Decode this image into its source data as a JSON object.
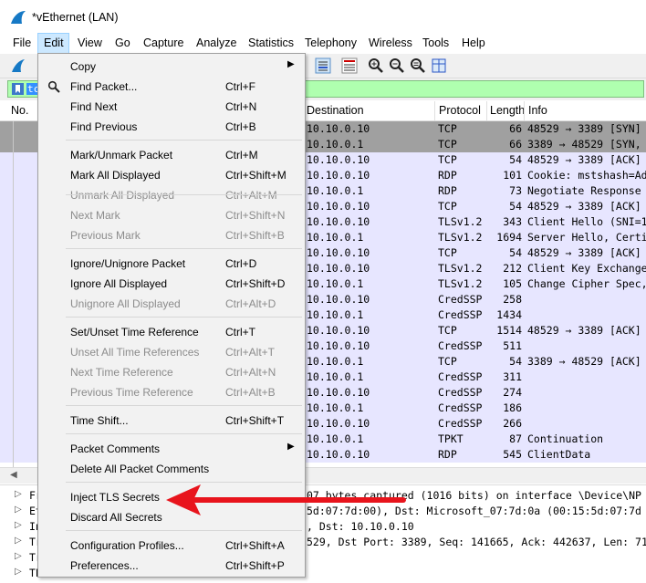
{
  "window": {
    "title": "*vEthernet (LAN)"
  },
  "menubar": {
    "items": [
      "File",
      "Edit",
      "View",
      "Go",
      "Capture",
      "Analyze",
      "Statistics",
      "Telephony",
      "Wireless",
      "Tools",
      "Help"
    ]
  },
  "filter": {
    "text": "tc"
  },
  "packet_list": {
    "headers": {
      "no": "No.",
      "destination": "Destination",
      "protocol": "Protocol",
      "length": "Length",
      "info": "Info"
    },
    "rows": [
      {
        "dst": "10.10.0.10",
        "proto": "TCP",
        "len": "66",
        "info": "48529 → 3389 [SYN]",
        "style": "selected"
      },
      {
        "dst": "10.10.0.1",
        "proto": "TCP",
        "len": "66",
        "info": "3389 → 48529 [SYN,",
        "style": "selected"
      },
      {
        "dst": "10.10.0.10",
        "proto": "TCP",
        "len": "54",
        "info": "48529 → 3389 [ACK]",
        "style": "normal"
      },
      {
        "dst": "10.10.0.10",
        "proto": "RDP",
        "len": "101",
        "info": "Cookie: mstshash=Ad",
        "style": "normal"
      },
      {
        "dst": "10.10.0.1",
        "proto": "RDP",
        "len": "73",
        "info": "Negotiate Response",
        "style": "normal"
      },
      {
        "dst": "10.10.0.10",
        "proto": "TCP",
        "len": "54",
        "info": "48529 → 3389 [ACK]",
        "style": "normal"
      },
      {
        "dst": "10.10.0.10",
        "proto": "TLSv1.2",
        "len": "343",
        "info": "Client Hello (SNI=1",
        "style": "normal"
      },
      {
        "dst": "10.10.0.1",
        "proto": "TLSv1.2",
        "len": "1694",
        "info": "Server Hello, Certi",
        "style": "normal"
      },
      {
        "dst": "10.10.0.10",
        "proto": "TCP",
        "len": "54",
        "info": "48529 → 3389 [ACK]",
        "style": "normal"
      },
      {
        "dst": "10.10.0.10",
        "proto": "TLSv1.2",
        "len": "212",
        "info": "Client Key Exchange",
        "style": "normal"
      },
      {
        "dst": "10.10.0.1",
        "proto": "TLSv1.2",
        "len": "105",
        "info": "Change Cipher Spec,",
        "style": "normal"
      },
      {
        "dst": "10.10.0.10",
        "proto": "CredSSP",
        "len": "258",
        "info": "",
        "style": "normal"
      },
      {
        "dst": "10.10.0.1",
        "proto": "CredSSP",
        "len": "1434",
        "info": "",
        "style": "normal"
      },
      {
        "dst": "10.10.0.10",
        "proto": "TCP",
        "len": "1514",
        "info": "48529 → 3389 [ACK]",
        "style": "normal"
      },
      {
        "dst": "10.10.0.10",
        "proto": "CredSSP",
        "len": "511",
        "info": "",
        "style": "normal"
      },
      {
        "dst": "10.10.0.1",
        "proto": "TCP",
        "len": "54",
        "info": "3389 → 48529 [ACK]",
        "style": "normal"
      },
      {
        "dst": "10.10.0.1",
        "proto": "CredSSP",
        "len": "311",
        "info": "",
        "style": "normal"
      },
      {
        "dst": "10.10.0.10",
        "proto": "CredSSP",
        "len": "274",
        "info": "",
        "style": "normal"
      },
      {
        "dst": "10.10.0.1",
        "proto": "CredSSP",
        "len": "186",
        "info": "",
        "style": "normal"
      },
      {
        "dst": "10.10.0.10",
        "proto": "CredSSP",
        "len": "266",
        "info": "",
        "style": "normal"
      },
      {
        "dst": "10.10.0.1",
        "proto": "TPKT",
        "len": "87",
        "info": "Continuation",
        "style": "normal"
      },
      {
        "dst": "10.10.0.10",
        "proto": "RDP",
        "len": "545",
        "info": "ClientData",
        "style": "normal"
      }
    ]
  },
  "details": {
    "rows": [
      {
        "prefix": "Fr",
        "text": "07 bytes captured (1016 bits) on interface \\Device\\NP"
      },
      {
        "prefix": "Et",
        "text": "5d:07:7d:00), Dst: Microsoft_07:7d:0a (00:15:5d:07:7d"
      },
      {
        "prefix": "In",
        "text": ", Dst: 10.10.0.10"
      },
      {
        "prefix": "Tr",
        "text": "529, Dst Port: 3389, Seq: 141665, Ack: 442637, Len: 71"
      },
      {
        "prefix": "Tr",
        "text": ""
      },
      {
        "prefix": "TP",
        "text": ""
      }
    ]
  },
  "edit_menu": {
    "items": [
      {
        "label": "Copy",
        "shortcut": "",
        "submenu": true,
        "disabled": false
      },
      {
        "label": "Find Packet...",
        "shortcut": "Ctrl+F",
        "disabled": false,
        "icon": "magnifier-icon"
      },
      {
        "label": "Find Next",
        "shortcut": "Ctrl+N",
        "disabled": false
      },
      {
        "label": "Find Previous",
        "shortcut": "Ctrl+B",
        "disabled": false
      },
      {
        "label": "Mark/Unmark Packet",
        "shortcut": "Ctrl+M",
        "disabled": false
      },
      {
        "label": "Mark All Displayed",
        "shortcut": "Ctrl+Shift+M",
        "disabled": false
      },
      {
        "label": "Unmark All Displayed",
        "shortcut": "Ctrl+Alt+M",
        "disabled": true
      },
      {
        "label": "Next Mark",
        "shortcut": "Ctrl+Shift+N",
        "disabled": true
      },
      {
        "label": "Previous Mark",
        "shortcut": "Ctrl+Shift+B",
        "disabled": true
      },
      {
        "label": "Ignore/Unignore Packet",
        "shortcut": "Ctrl+D",
        "disabled": false
      },
      {
        "label": "Ignore All Displayed",
        "shortcut": "Ctrl+Shift+D",
        "disabled": false
      },
      {
        "label": "Unignore All Displayed",
        "shortcut": "Ctrl+Alt+D",
        "disabled": true
      },
      {
        "label": "Set/Unset Time Reference",
        "shortcut": "Ctrl+T",
        "disabled": false
      },
      {
        "label": "Unset All Time References",
        "shortcut": "Ctrl+Alt+T",
        "disabled": true
      },
      {
        "label": "Next Time Reference",
        "shortcut": "Ctrl+Alt+N",
        "disabled": true
      },
      {
        "label": "Previous Time Reference",
        "shortcut": "Ctrl+Alt+B",
        "disabled": true
      },
      {
        "label": "Time Shift...",
        "shortcut": "Ctrl+Shift+T",
        "disabled": false
      },
      {
        "label": "Packet Comments",
        "shortcut": "",
        "submenu": true,
        "disabled": false
      },
      {
        "label": "Delete All Packet Comments",
        "shortcut": "",
        "disabled": false
      },
      {
        "label": "Inject TLS Secrets",
        "shortcut": "",
        "disabled": false
      },
      {
        "label": "Discard All Secrets",
        "shortcut": "",
        "disabled": false
      },
      {
        "label": "Configuration Profiles...",
        "shortcut": "Ctrl+Shift+A",
        "disabled": false
      },
      {
        "label": "Preferences...",
        "shortcut": "Ctrl+Shift+P",
        "disabled": false
      }
    ]
  },
  "colors": {
    "row_normal": "#e7e6ff",
    "row_selected": "#a0a0a0",
    "filter_bg": "#afffaf",
    "annotation": "#e8141c"
  }
}
